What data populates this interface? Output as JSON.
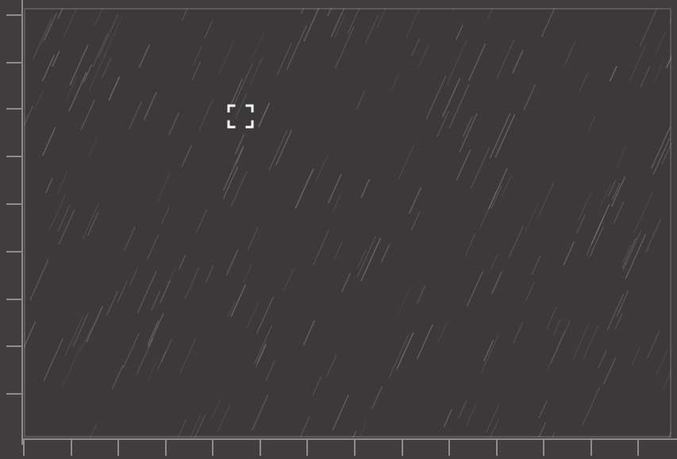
{
  "viewer": {
    "background_color": "#3b3939",
    "frame_color": "#5a5858",
    "rain_color": "#bdbdbd",
    "icons": {
      "focus": "focus-frame-icon"
    }
  }
}
